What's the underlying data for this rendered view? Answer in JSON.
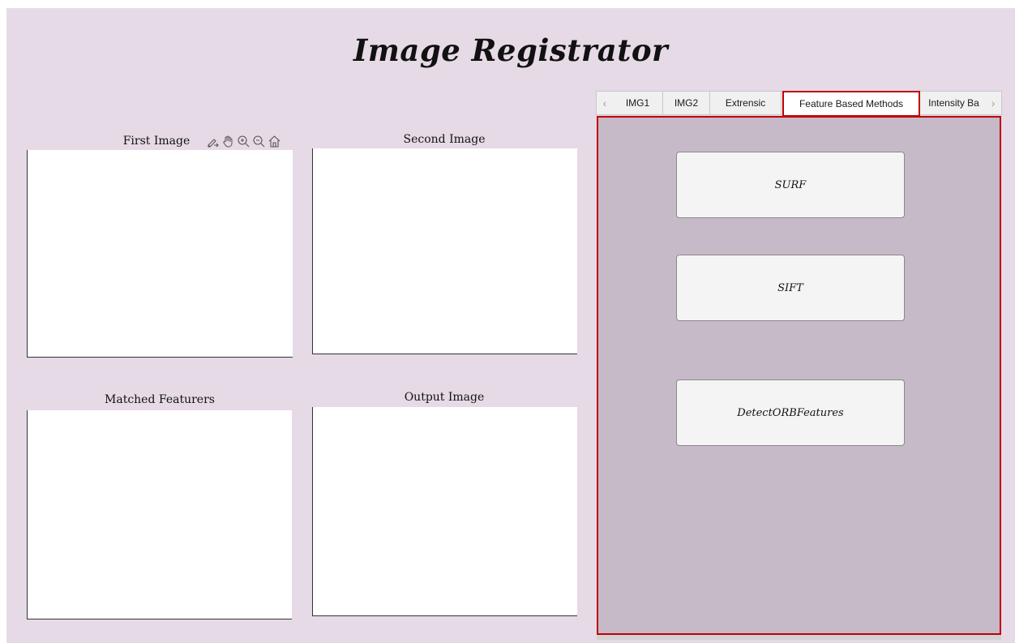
{
  "app": {
    "title": "Image Registrator"
  },
  "axes": {
    "first": {
      "label": "First Image"
    },
    "second": {
      "label": "Second Image"
    },
    "matched": {
      "label": "Matched Featurers"
    },
    "output": {
      "label": "Output Image"
    }
  },
  "toolbar": {
    "icons": [
      "export-icon",
      "pan-hand-icon",
      "zoom-in-icon",
      "zoom-out-icon",
      "home-icon"
    ]
  },
  "tabs": {
    "items": [
      "IMG1",
      "IMG2",
      "Extrensic",
      "Feature Based Methods",
      "Intensity Ba"
    ],
    "active": "Feature Based Methods",
    "scroll_left_icon": "chevron-left-icon",
    "scroll_right_icon": "chevron-right-icon"
  },
  "feature_methods": {
    "surf_label": "SURF",
    "sift_label": "SIFT",
    "orb_label": "DetectORBFeatures"
  },
  "colors": {
    "background": "#e6dae7",
    "panel": "#c6b9c8",
    "highlight": "#c00000"
  }
}
